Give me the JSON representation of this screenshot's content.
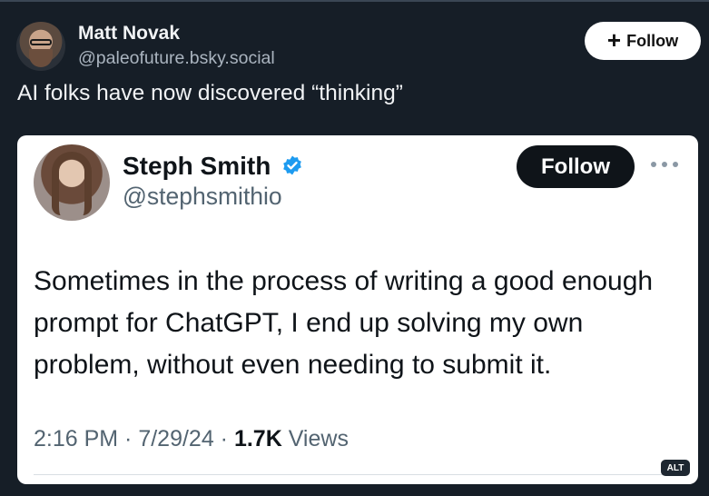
{
  "post": {
    "author_name": "Matt Novak",
    "author_handle": "@paleofuture.bsky.social",
    "follow_label": "Follow",
    "text": "AI folks have now discovered “thinking”"
  },
  "embed": {
    "author_name": "Steph Smith",
    "author_handle": "@stephsmithio",
    "verified": true,
    "follow_label": "Follow",
    "text": "Sometimes in the process of writing a good enough prompt for ChatGPT, I end up solving my own problem, without even needing to submit it.",
    "time": "2:16 PM · 7/29/24 · ",
    "views_count": "1.7K",
    "views_label": " Views",
    "alt_badge": "ALT"
  },
  "colors": {
    "background": "#161e27",
    "embed_background": "#ffffff",
    "verified_blue": "#1d9bf0"
  },
  "icons": [
    "plus-icon",
    "verified-badge-icon",
    "more-options-icon"
  ]
}
